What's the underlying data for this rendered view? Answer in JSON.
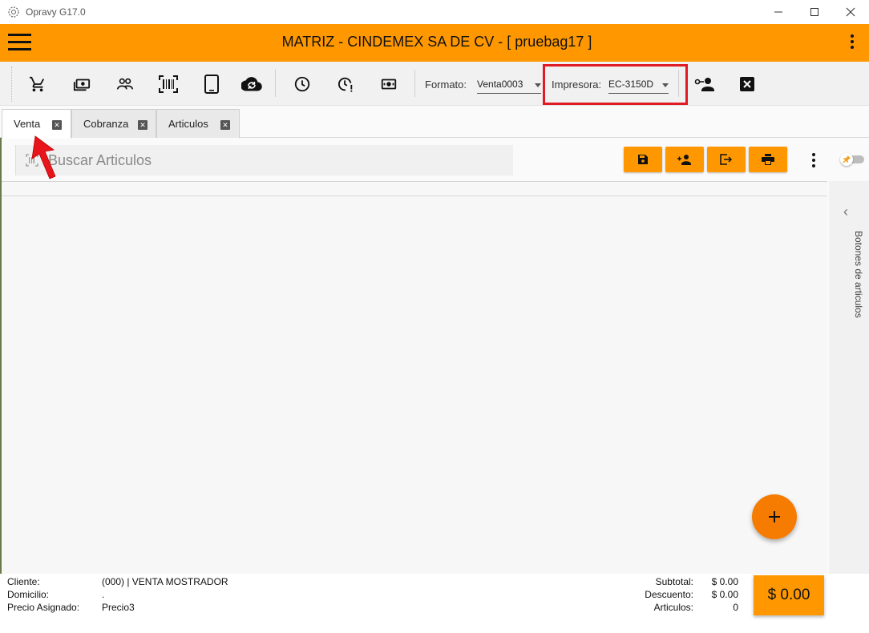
{
  "window": {
    "title": "Opravy G17.0",
    "buttons": [
      "minimize",
      "maximize",
      "close"
    ]
  },
  "header": {
    "title": "MATRIZ - CINDEMEX SA DE CV - [ pruebag17 ]"
  },
  "toolbar": {
    "icons": [
      "cart-icon",
      "cash-icon",
      "customers-icon",
      "barcode-icon",
      "tablet-icon",
      "cloud-sync-icon",
      "clock-icon",
      "clock-alert-icon",
      "money-icon"
    ],
    "formato_label": "Formato:",
    "formato_value": "Venta0003",
    "impresora_label": "Impresora:",
    "impresora_value": "EC-3150D",
    "right_icons": [
      "person-key-icon",
      "close-box-icon"
    ]
  },
  "tabs": [
    {
      "label": "Venta",
      "active": true
    },
    {
      "label": "Cobranza",
      "active": false
    },
    {
      "label": "Articulos",
      "active": false
    }
  ],
  "search": {
    "placeholder": "Buscar Articulos"
  },
  "actions": [
    "save-icon",
    "add-person-icon",
    "export-icon",
    "print-icon"
  ],
  "side_panel": {
    "label": "Botones de articulos"
  },
  "footer": {
    "cliente_label": "Cliente:",
    "cliente_value": "(000) | VENTA MOSTRADOR",
    "domicilio_label": "Domicilio:",
    "domicilio_value": ".",
    "precio_label": "Precio Asignado:",
    "precio_value": "Precio3",
    "subtotal_label": "Subtotal:",
    "subtotal_value": "$ 0.00",
    "descuento_label": "Descuento:",
    "descuento_value": "$ 0.00",
    "articulos_label": "Articulos:",
    "articulos_value": "0",
    "total": "$ 0.00"
  },
  "colors": {
    "accent": "#ff9800",
    "fab": "#f57c00",
    "highlight": "#e01b24"
  }
}
